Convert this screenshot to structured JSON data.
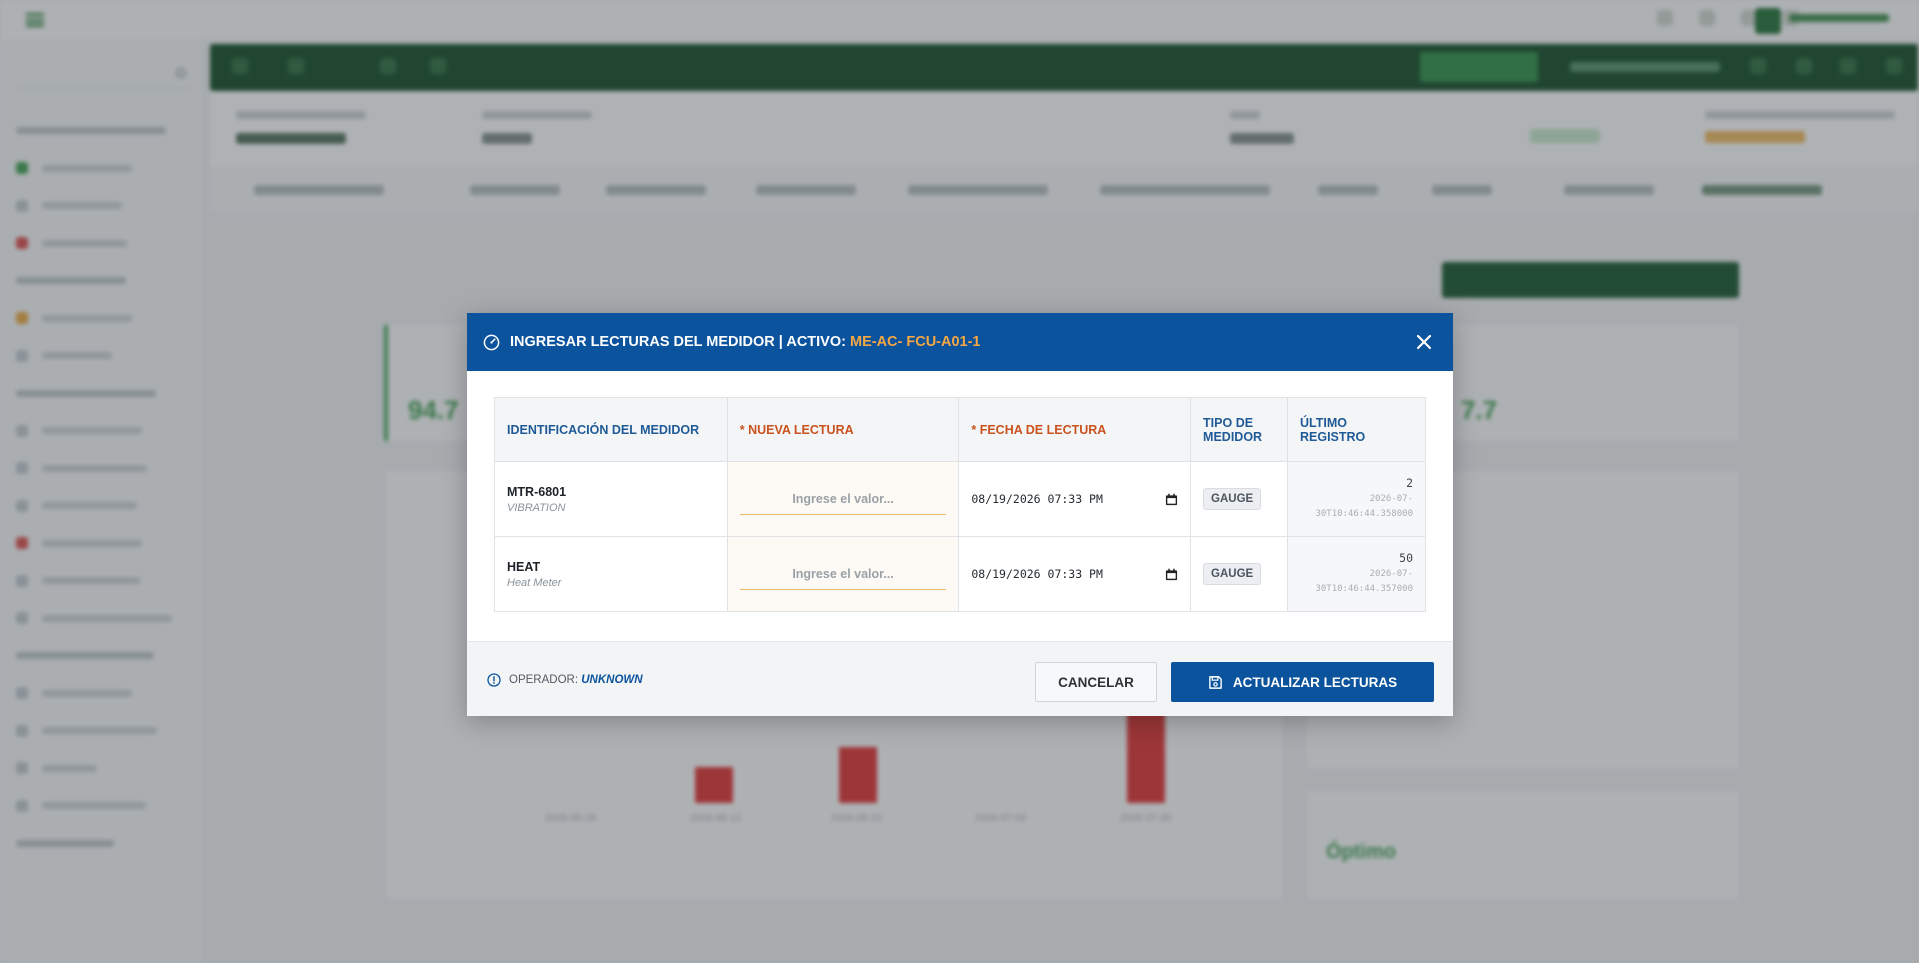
{
  "modal": {
    "title_prefix": "INGRESAR LECTURAS DEL MEDIDOR | ACTIVO:",
    "asset_id": "ME-AC- FCU-A01-1",
    "columns": {
      "meter_id": "IDENTIFICACIÓN DEL MEDIDOR",
      "new_reading": "* NUEVA LECTURA",
      "reading_date": "* FECHA DE LECTURA",
      "meter_type": "TIPO DE MEDIDOR",
      "last_record": "ÚLTIMO REGISTRO"
    },
    "rows": [
      {
        "id": "MTR-6801",
        "type": "VIBRATION",
        "placeholder": "Ingrese el valor...",
        "date": "08/19/2026 07:33 PM",
        "meter_kind": "GAUGE",
        "last_value": "2",
        "last_date_1": "2026-07-",
        "last_date_2": "30T10:46:44.358000"
      },
      {
        "id": "HEAT",
        "type": "Heat Meter",
        "placeholder": "Ingrese el valor...",
        "date": "08/19/2026 07:33 PM",
        "meter_kind": "GAUGE",
        "last_value": "50",
        "last_date_1": "2026-07-",
        "last_date_2": "30T10:46:44.357000"
      }
    ],
    "footer": {
      "operator_label": "OPERADOR:",
      "operator_value": "UNKNOWN",
      "cancel_label": "CANCELAR",
      "update_label": "ACTUALIZAR LECTURAS"
    }
  },
  "colors": {
    "primary_blue": "#0b539c",
    "asset_orange": "#f5a743",
    "required_orange": "#c9521e",
    "background_green": "#0f4a24"
  },
  "icons": [
    "gauge-icon",
    "close-icon",
    "calendar-icon",
    "info-icon",
    "save-icon"
  ]
}
